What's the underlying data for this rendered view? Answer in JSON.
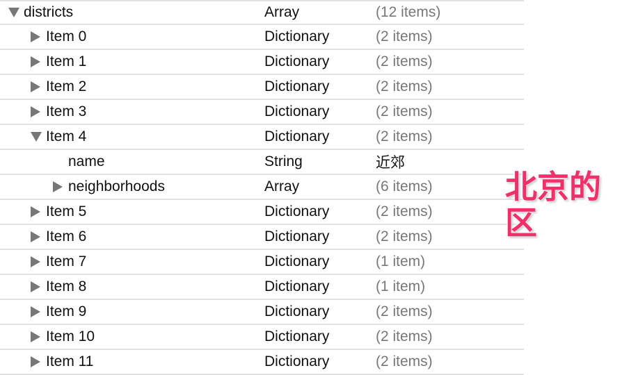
{
  "rows": [
    {
      "key": "districts",
      "type": "Array",
      "value": "(12 items)",
      "level": 0,
      "expander": "open"
    },
    {
      "key": "Item 0",
      "type": "Dictionary",
      "value": "(2 items)",
      "level": 1,
      "expander": "closed"
    },
    {
      "key": "Item 1",
      "type": "Dictionary",
      "value": "(2 items)",
      "level": 1,
      "expander": "closed"
    },
    {
      "key": "Item 2",
      "type": "Dictionary",
      "value": "(2 items)",
      "level": 1,
      "expander": "closed"
    },
    {
      "key": "Item 3",
      "type": "Dictionary",
      "value": "(2 items)",
      "level": 1,
      "expander": "closed"
    },
    {
      "key": "Item 4",
      "type": "Dictionary",
      "value": "(2 items)",
      "level": 1,
      "expander": "open"
    },
    {
      "key": "name",
      "type": "String",
      "value": "近郊",
      "level": 2,
      "expander": "none"
    },
    {
      "key": "neighborhoods",
      "type": "Array",
      "value": "(6 items)",
      "level": 2,
      "expander": "closed"
    },
    {
      "key": "Item 5",
      "type": "Dictionary",
      "value": "(2 items)",
      "level": 1,
      "expander": "closed"
    },
    {
      "key": "Item 6",
      "type": "Dictionary",
      "value": "(2 items)",
      "level": 1,
      "expander": "closed"
    },
    {
      "key": "Item 7",
      "type": "Dictionary",
      "value": "(1 item)",
      "level": 1,
      "expander": "closed"
    },
    {
      "key": "Item 8",
      "type": "Dictionary",
      "value": "(1 item)",
      "level": 1,
      "expander": "closed"
    },
    {
      "key": "Item 9",
      "type": "Dictionary",
      "value": "(2 items)",
      "level": 1,
      "expander": "closed"
    },
    {
      "key": "Item 10",
      "type": "Dictionary",
      "value": "(2 items)",
      "level": 1,
      "expander": "closed"
    },
    {
      "key": "Item 11",
      "type": "Dictionary",
      "value": "(2 items)",
      "level": 1,
      "expander": "closed"
    }
  ],
  "annotation": {
    "line1": "北京的",
    "line2": "区",
    "color": "#f0306a"
  }
}
